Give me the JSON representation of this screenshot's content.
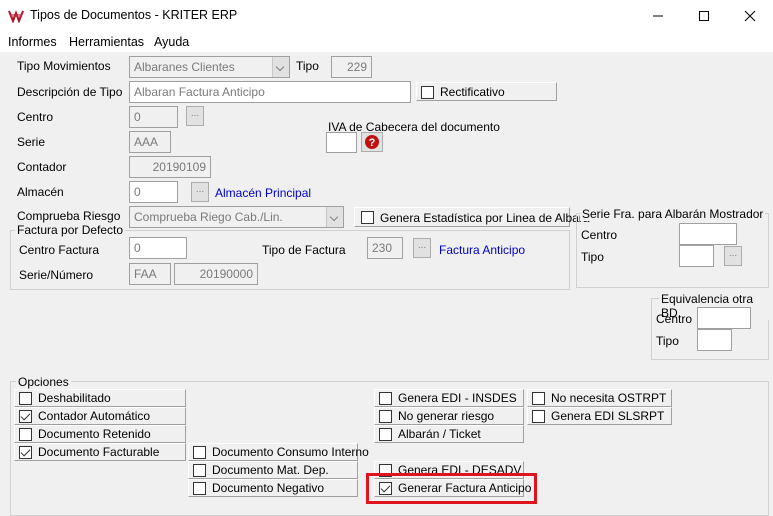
{
  "window": {
    "title": "Tipos de Documentos - KRITER ERP"
  },
  "menu": [
    "Informes",
    "Herramientas",
    "Ayuda"
  ],
  "form": {
    "tipo_mov_label": "Tipo Movimientos",
    "tipo_mov_value": "Albaranes Clientes",
    "tipo_label": "Tipo",
    "tipo_value": "229",
    "desc_label": "Descripción de Tipo",
    "desc_value": "Albaran Factura Anticipo",
    "rectificativo": "Rectificativo",
    "centro_label": "Centro",
    "centro_value": "0",
    "serie_label": "Serie",
    "serie_value": "AAA",
    "iva_label": "IVA de Cabecera del documento",
    "contador_label": "Contador",
    "contador_value": "20190109",
    "almacen_label": "Almacén",
    "almacen_value": "0",
    "almacen_link": "Almacén Principal",
    "comprueba_label": "Comprueba Riesgo",
    "comprueba_value": "Comprueba Riego Cab./Lin.",
    "genera_estadistica": "Genera Estadística por Linea de Albará",
    "factura_group": "Factura por Defecto",
    "centro_factura_label": "Centro Factura",
    "centro_factura_value": "0",
    "serie_num_label": "Serie/Número",
    "serie_value2": "FAA",
    "numero_value": "20190000",
    "tipo_factura_label": "Tipo de Factura",
    "tipo_factura_value": "230",
    "tipo_factura_link": "Factura Anticipo",
    "serie_fra_group": "Serie Fra. para Albarán Mostrador",
    "sf_centro_label": "Centro",
    "sf_tipo_label": "Tipo",
    "equiv_group": "Equivalencia otra BD",
    "eq_centro_label": "Centro",
    "eq_tipo_label": "Tipo",
    "opciones_group": "Opciones"
  },
  "options": {
    "col1": [
      {
        "label": "Deshabilitado",
        "checked": false
      },
      {
        "label": "Contador Automático",
        "checked": true
      },
      {
        "label": "Documento Retenido",
        "checked": false
      },
      {
        "label": "Documento Facturable",
        "checked": true
      }
    ],
    "col2": [
      {
        "label": "Documento Consumo Interno",
        "checked": false
      },
      {
        "label": "Documento Mat. Dep.",
        "checked": false
      },
      {
        "label": "Documento Negativo",
        "checked": false
      }
    ],
    "col3": [
      {
        "label": "Genera EDI - INSDES",
        "checked": false
      },
      {
        "label": "No generar riesgo",
        "checked": false
      },
      {
        "label": "Albarán / Ticket",
        "checked": false
      },
      {
        "label": "Genera EDI - DESADV",
        "checked": false
      },
      {
        "label": "Generar Factura Anticipo",
        "checked": true
      }
    ],
    "col4": [
      {
        "label": "No necesita OSTRPT",
        "checked": false
      },
      {
        "label": "Genera EDI SLSRPT",
        "checked": false
      }
    ]
  },
  "colors": {
    "highlight": "#e0141e",
    "link": "#0000cc"
  }
}
